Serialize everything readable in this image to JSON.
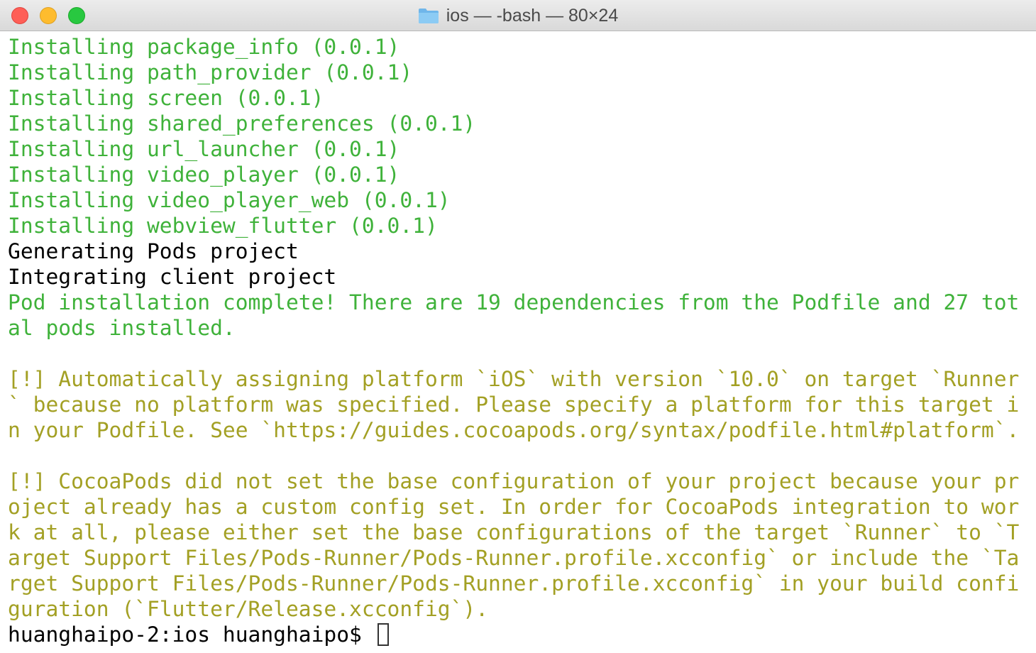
{
  "window": {
    "title": "ios — -bash — 80×24",
    "folder_icon": "folder-icon"
  },
  "terminal": {
    "lines": [
      {
        "text": "Installing package_info (0.0.1)",
        "color": "#3fb23a"
      },
      {
        "text": "Installing path_provider (0.0.1)",
        "color": "#3fb23a"
      },
      {
        "text": "Installing screen (0.0.1)",
        "color": "#3fb23a"
      },
      {
        "text": "Installing shared_preferences (0.0.1)",
        "color": "#3fb23a"
      },
      {
        "text": "Installing url_launcher (0.0.1)",
        "color": "#3fb23a"
      },
      {
        "text": "Installing video_player (0.0.1)",
        "color": "#3fb23a"
      },
      {
        "text": "Installing video_player_web (0.0.1)",
        "color": "#3fb23a"
      },
      {
        "text": "Installing webview_flutter (0.0.1)",
        "color": "#3fb23a"
      },
      {
        "text": "Generating Pods project",
        "color": "#000000"
      },
      {
        "text": "Integrating client project",
        "color": "#000000"
      },
      {
        "text": "Pod installation complete! There are 19 dependencies from the Podfile and 27 tot",
        "color": "#3fb23a"
      },
      {
        "text": "al pods installed.",
        "color": "#3fb23a"
      },
      {
        "text": "",
        "color": "#000000"
      },
      {
        "text": "[!] Automatically assigning platform `iOS` with version `10.0` on target `Runner",
        "color": "#a3a024"
      },
      {
        "text": "` because no platform was specified. Please specify a platform for this target i",
        "color": "#a3a024"
      },
      {
        "text": "n your Podfile. See `https://guides.cocoapods.org/syntax/podfile.html#platform`.",
        "color": "#a3a024"
      },
      {
        "text": "",
        "color": "#000000"
      },
      {
        "text": "[!] CocoaPods did not set the base configuration of your project because your pr",
        "color": "#a3a024"
      },
      {
        "text": "oject already has a custom config set. In order for CocoaPods integration to wor",
        "color": "#a3a024"
      },
      {
        "text": "k at all, please either set the base configurations of the target `Runner` to `T",
        "color": "#a3a024"
      },
      {
        "text": "arget Support Files/Pods-Runner/Pods-Runner.profile.xcconfig` or include the `Ta",
        "color": "#a3a024"
      },
      {
        "text": "rget Support Files/Pods-Runner/Pods-Runner.profile.xcconfig` in your build confi",
        "color": "#a3a024"
      },
      {
        "text": "guration (`Flutter/Release.xcconfig`).",
        "color": "#a3a024"
      }
    ],
    "prompt": "huanghaipo-2:ios huanghaipo$ "
  }
}
